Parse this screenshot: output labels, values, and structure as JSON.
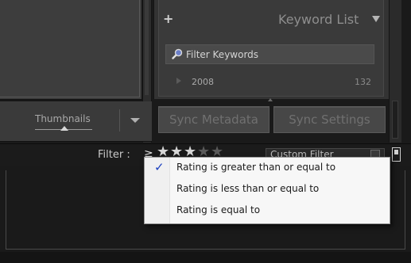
{
  "left_toolbar": {
    "view_label": "Thumbnails"
  },
  "keyword_panel": {
    "add_symbol": "+",
    "title": "Keyword List",
    "filter_placeholder": "Filter Keywords",
    "keywords": [
      {
        "name": "2008",
        "count": "132"
      }
    ]
  },
  "sync": {
    "metadata_label": "Sync Metadata",
    "settings_label": "Sync Settings"
  },
  "filter_bar": {
    "label": "Filter :",
    "operator_symbol": "≥",
    "stars_filled": 3,
    "stars_total": 5,
    "star_char": "★",
    "preset": "Custom Filter"
  },
  "rating_menu": {
    "items": [
      {
        "label": "Rating is greater than or equal to",
        "checked": true
      },
      {
        "label": "Rating is less than or equal to",
        "checked": false
      },
      {
        "label": "Rating is equal to",
        "checked": false
      }
    ],
    "check_glyph": "✓"
  },
  "colors": {
    "panel": "#3d3d3d",
    "background": "#1a1a1a",
    "menu_background": "#f7f7f7",
    "check": "#1a3fbf",
    "star_filled": "#d6d6d6",
    "star_empty": "#5a5a5a"
  }
}
